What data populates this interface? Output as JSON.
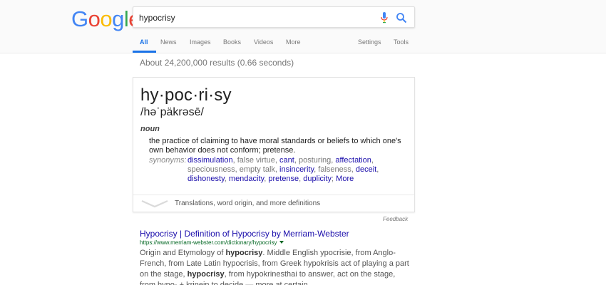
{
  "logo": {
    "letters": [
      "G",
      "o",
      "o",
      "g",
      "l",
      "e"
    ],
    "colors": [
      "#4285f4",
      "#ea4335",
      "#fbbc05",
      "#4285f4",
      "#34a853",
      "#ea4335"
    ]
  },
  "search": {
    "query": "hypocrisy"
  },
  "tabs": {
    "all": "All",
    "news": "News",
    "images": "Images",
    "books": "Books",
    "videos": "Videos",
    "more": "More",
    "settings": "Settings",
    "tools": "Tools"
  },
  "stats": "About 24,200,000 results (0.66 seconds)",
  "dictionary": {
    "word": "hy·poc·ri·sy",
    "pronunciation": "/həˈpäkrəsē/",
    "part_of_speech": "noun",
    "definition": "the practice of claiming to have moral standards or beliefs to which one's own behavior does not conform; pretense.",
    "synonyms_label": "synonyms:",
    "synonyms": [
      {
        "text": "dissimulation",
        "link": true
      },
      {
        "text": "false virtue",
        "link": false
      },
      {
        "text": "cant",
        "link": true
      },
      {
        "text": "posturing",
        "link": false
      },
      {
        "text": "affectation",
        "link": true
      },
      {
        "text": "speciousness",
        "link": false
      },
      {
        "text": "empty talk",
        "link": false
      },
      {
        "text": "insincerity",
        "link": true
      },
      {
        "text": "falseness",
        "link": false
      },
      {
        "text": "deceit",
        "link": true
      },
      {
        "text": "dishonesty",
        "link": true
      },
      {
        "text": "mendacity",
        "link": true
      },
      {
        "text": "pretense",
        "link": true
      },
      {
        "text": "duplicity",
        "link": true
      }
    ],
    "more_label": "More",
    "footer": "Translations, word origin, and more definitions"
  },
  "feedback": "Feedback",
  "result": {
    "title": "Hypocrisy | Definition of Hypocrisy by Merriam-Webster",
    "url": "https://www.merriam-webster.com/dictionary/hypocrisy",
    "snippet_parts": [
      {
        "t": "Origin and Etymology of ",
        "b": false
      },
      {
        "t": "hypocrisy",
        "b": true
      },
      {
        "t": ". Middle English ypocrisie, from Anglo-French, from Late Latin hypocrisis, from Greek hypokrisis act of playing a part on the stage, ",
        "b": false
      },
      {
        "t": "hypocrisy",
        "b": true
      },
      {
        "t": ", from hypokrinesthai to answer, act on the stage, from hypo- + krinein to decide — more at certain.",
        "b": false
      }
    ]
  }
}
